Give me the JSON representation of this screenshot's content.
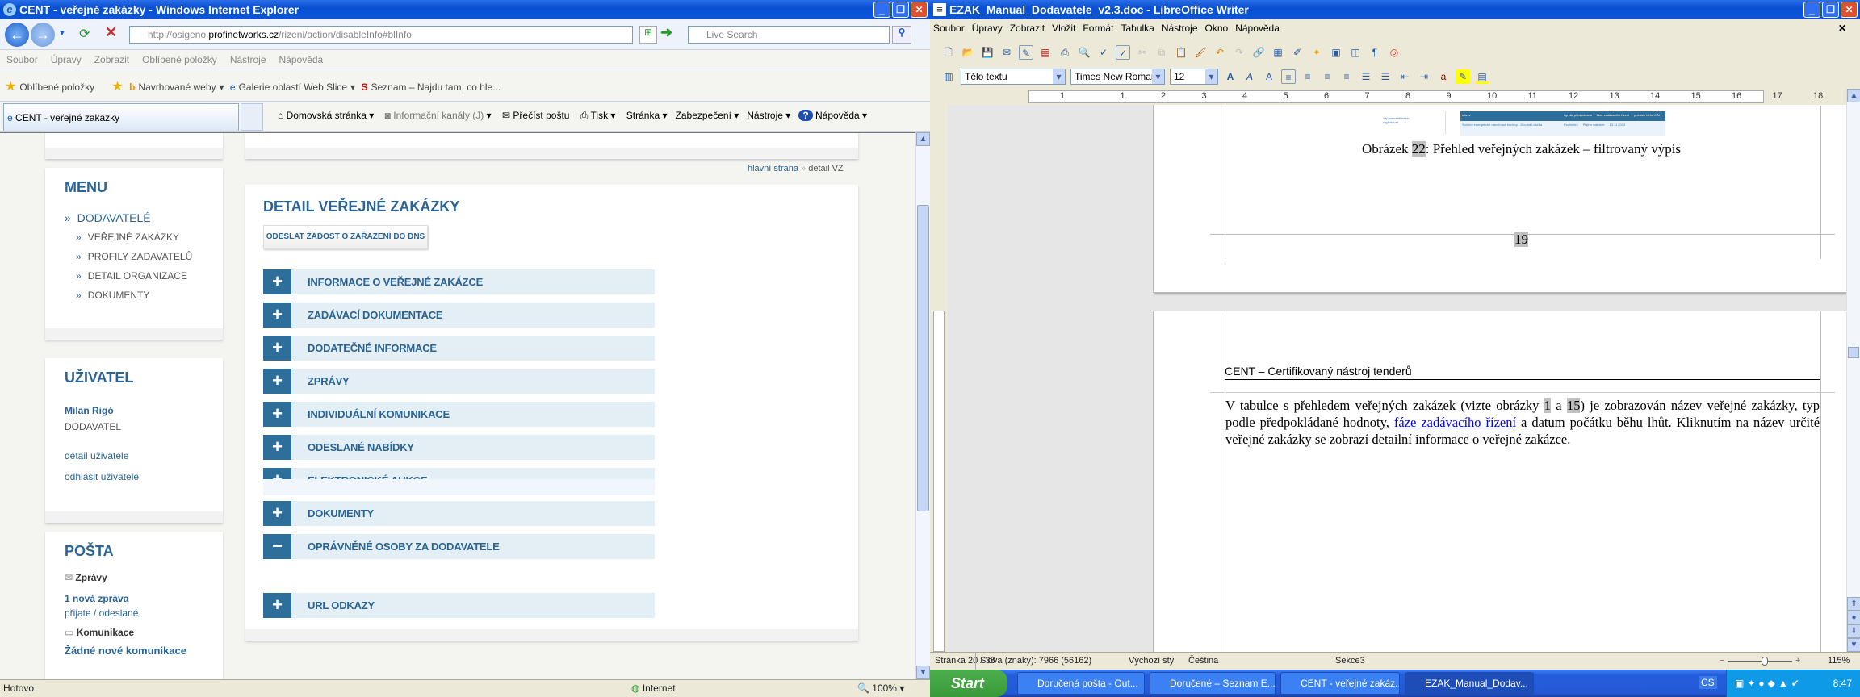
{
  "ie": {
    "title": "CENT - veřejné zakázky - Windows Internet Explorer",
    "address_pre": "http://osigeno.",
    "address_domain": "profinetworks.cz",
    "address_post": "/rizeni/action/disableInfo#blInfo",
    "search_placeholder": "Live Search",
    "menu": [
      "Soubor",
      "Úpravy",
      "Zobrazit",
      "Oblíbené položky",
      "Nástroje",
      "Nápověda"
    ],
    "favorites": {
      "label": "Oblíbené položky",
      "items": [
        "Navrhované weby",
        "Galerie oblastí Web Slice",
        "Seznam – Najdu tam, co hle..."
      ]
    },
    "tab": "CENT - veřejné zakázky",
    "commands": [
      "Domovská stránka",
      "Informační kanály (J)",
      "Přečíst poštu",
      "Tisk",
      "Stránka",
      "Zabezpečení",
      "Nástroje",
      "Nápověda"
    ],
    "status": {
      "text": "Hotovo",
      "zone": "Internet",
      "zoom": "100%"
    }
  },
  "page": {
    "breadcrumb": {
      "home": "hlavní strana",
      "sep": "»",
      "current": "detail VZ"
    },
    "menu": {
      "title": "MENU",
      "section": "DODAVATELÉ",
      "items": [
        "VEŘEJNÉ ZAKÁZKY",
        "PROFILY ZADAVATELŮ",
        "DETAIL ORGANIZACE",
        "DOKUMENTY"
      ]
    },
    "user": {
      "title": "UŽIVATEL",
      "name": "Milan Rigó",
      "role": "DODAVATEL",
      "links": [
        "detail uživatele",
        "odhlásit uživatele"
      ]
    },
    "mail": {
      "title": "POŠTA",
      "messages_label": "Zprávy",
      "new_messages": "1 nová zpráva",
      "received_sent": "přijate / odeslané",
      "communications_label": "Komunikace",
      "no_comm": "Žádné nové komunikace"
    },
    "detail": {
      "title": "DETAIL VEŘEJNÉ ZAKÁZKY",
      "dns_button": "ODESLAT ŽÁDOST O ZAŘAZENÍ DO DNS",
      "sections": [
        {
          "label": "INFORMACE O VEŘEJNÉ ZAKÁZCE",
          "state": "+"
        },
        {
          "label": "ZADÁVACÍ DOKUMENTACE",
          "state": "+"
        },
        {
          "label": "DODATEČNÉ INFORMACE",
          "state": "+"
        },
        {
          "label": "ZPRÁVY",
          "state": "+"
        },
        {
          "label": "INDIVIDUÁLNÍ KOMUNIKACE",
          "state": "+"
        },
        {
          "label": "ODESLANÉ NABÍDKY",
          "state": "+"
        },
        {
          "label": "ELEKTRONICKÉ AUKCE",
          "state": "+"
        },
        {
          "label": "DOKUMENTY",
          "state": "+"
        },
        {
          "label": "OPRÁVNĚNÉ OSOBY ZA DODAVATELE",
          "state": "−"
        },
        {
          "label": "URL ODKAZY",
          "state": "+"
        }
      ]
    }
  },
  "lo": {
    "title": "EZAK_Manual_Dodavatele_v2.3.doc - LibreOffice Writer",
    "menu": [
      "Soubor",
      "Úpravy",
      "Zobrazit",
      "Vložit",
      "Formát",
      "Tabulka",
      "Nástroje",
      "Okno",
      "Nápověda"
    ],
    "style": "Tělo textu",
    "font": "Times New Roman",
    "size": "12",
    "ruler": [
      "1",
      "1",
      "2",
      "3",
      "4",
      "5",
      "6",
      "7",
      "8",
      "9",
      "10",
      "11",
      "12",
      "13",
      "14",
      "15",
      "16",
      "17",
      "18"
    ],
    "doc": {
      "caption_pre": "Obrázek ",
      "caption_num": "22",
      "caption_post": ": Přehled veřejných zakázek – filtrovaný výpis",
      "thumb": {
        "links": [
          "zapomenuté heslo",
          "registrovat"
        ],
        "headers": [
          "název",
          "typ dle předpokladu",
          "fáze zadávacího řízení",
          "počátek běhu lhůt"
        ],
        "row": [
          "Snížení energetické náročnosti budovy - Dlouhá Loučka",
          "Podlimitní",
          "Příjem nabídek",
          "13.11.2013"
        ]
      },
      "page_number": "19",
      "header": "CENT – Certifikovaný nástroj tenderů",
      "p1": "V tabulce s přehledem veřejných zakázek (vizte obrázky ",
      "ref1": "1",
      " and": " a ",
      "ref2": "15",
      "p2": ") je zobrazován název veřejné zakázky, typ podle předpokládané hodnoty, ",
      "link": "fáze zadávacího řízení",
      "p3": " a datum počátku běhu lhůt. Kliknutím na název určité veřejné zakázky se zobrazí detailní informace o veřejné zakázce."
    },
    "status": {
      "page": "Stránka 20 / 38",
      "words": "Slova (znaky): 7966 (56162)",
      "style": "Výchozí styl",
      "lang": "Čeština",
      "section": "Sekce3",
      "zoom": "115%"
    },
    "zoom_percent": 115
  },
  "taskbar": {
    "start": "Start",
    "tasks": [
      "Doručená pošta - Out...",
      "Doručené – Seznam E...",
      "CENT - veřejné zakáz...",
      "EZAK_Manual_Dodav..."
    ],
    "lang": "CS",
    "clock": "8:47"
  }
}
